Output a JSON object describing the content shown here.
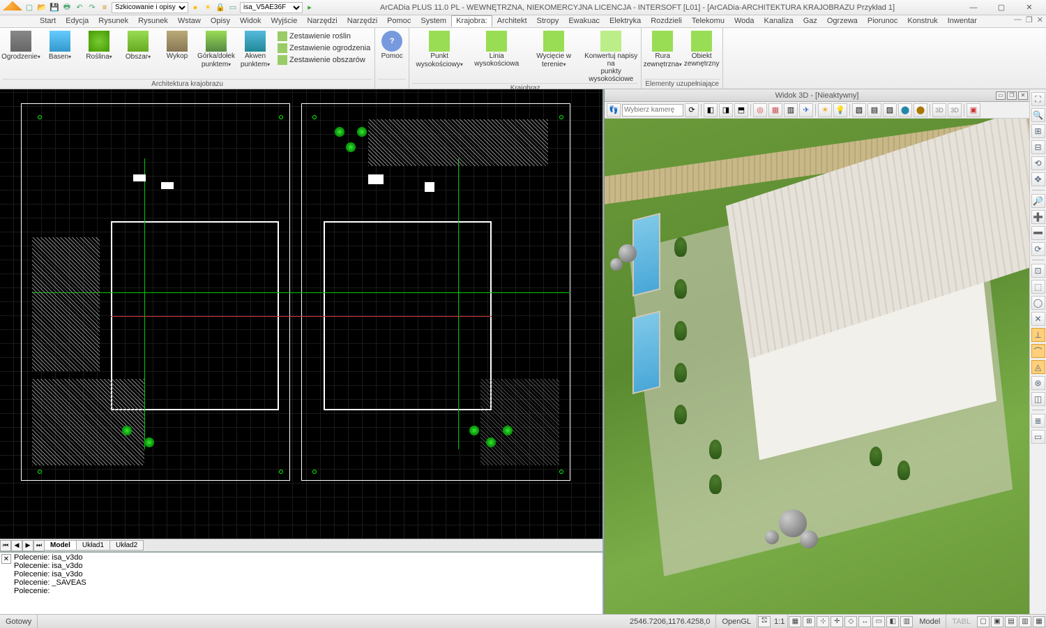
{
  "title": "ArCADia PLUS 11.0 PL - WEWNĘTRZNA, NIEKOMERCYJNA LICENCJA - INTERSOFT [L01] - [ArCADia-ARCHITEKTURA KRAJOBRAZU Przykład 1]",
  "qat": {
    "snap_dropdown": "Szkicowanie i opisy",
    "file_field": "isa_V5AE36F"
  },
  "menu": {
    "tabs": [
      "Start",
      "Edycja",
      "Rysunek",
      "Rysunek",
      "Wstaw",
      "Opisy",
      "Widok",
      "Wyjście",
      "Narzędzi",
      "Narzędzi",
      "Pomoc",
      "System",
      "Krajobra:",
      "Architekt",
      "Stropy",
      "Ewakuac",
      "Elektryka",
      "Rozdzieli",
      "Telekomu",
      "Woda",
      "Kanaliza",
      "Gaz",
      "Ogrzewa",
      "Piorunoc",
      "Konstruk",
      "Inwentar"
    ],
    "active": 12
  },
  "ribbon": {
    "g1": {
      "label": "Architektura krajobrazu",
      "btns": [
        {
          "l1": "Ogrodzenie",
          "caret": true,
          "ic": "ic-fence"
        },
        {
          "l1": "Basen",
          "caret": true,
          "ic": "ic-pool"
        },
        {
          "l1": "Roślina",
          "caret": true,
          "ic": "ic-tree"
        },
        {
          "l1": "Obszar",
          "caret": true,
          "ic": "ic-area"
        },
        {
          "l1": "Wykop",
          "caret": false,
          "ic": "ic-dig"
        },
        {
          "l1": "Górka/dołek",
          "l2": "punktem",
          "caret": true,
          "ic": "ic-hill"
        },
        {
          "l1": "Akwen",
          "l2": "punktem",
          "caret": true,
          "ic": "ic-water"
        }
      ],
      "small": [
        "Zestawienie roślin",
        "Zestawienie ogrodzenia",
        "Zestawienie obszarów"
      ]
    },
    "g2": {
      "btn": {
        "l1": "Pomoc",
        "ic": "ic-help",
        "txt": "?"
      }
    },
    "g3": {
      "label": "Krajobraz",
      "btns": [
        {
          "l1": "Punkt",
          "l2": "wysokościowy",
          "caret": true,
          "ic": "ic-pt",
          "wide": true
        },
        {
          "l1": "Linia",
          "l2": "wysokościowa",
          "ic": "ic-ln",
          "wide": true
        },
        {
          "l1": "Wycięcie w",
          "l2": "terenie",
          "caret": true,
          "ic": "ic-cut",
          "wide": true
        },
        {
          "l1": "Konwertuj napisy na",
          "l2": "punkty wysokościowe",
          "ic": "ic-conv",
          "wide": true
        }
      ]
    },
    "g4": {
      "label": "Elementy uzupełniające",
      "btns": [
        {
          "l1": "Rura",
          "l2": "zewnętrzna",
          "caret": true,
          "ic": "ic-pipe"
        },
        {
          "l1": "Obiekt",
          "l2": "zewnętrzny",
          "ic": "ic-obj"
        }
      ]
    }
  },
  "sheets": {
    "tabs": [
      "Model",
      "Układ1",
      "Układ2"
    ],
    "active": 0
  },
  "cmd": {
    "lines": [
      "Polecenie: isa_v3do",
      "Polecenie: isa_v3do",
      "Polecenie: isa_v3do",
      "Polecenie: _SAVEAS",
      "Polecenie:"
    ]
  },
  "view3d": {
    "title": "Widok 3D - [Nieaktywny]",
    "camera_placeholder": "Wybierz kamerę"
  },
  "status": {
    "ready": "Gotowy",
    "coords": "2546.7206,1176.4258,0",
    "renderer": "OpenGL",
    "scale": "1:1",
    "mode1": "Model",
    "mode2": "TABL"
  }
}
